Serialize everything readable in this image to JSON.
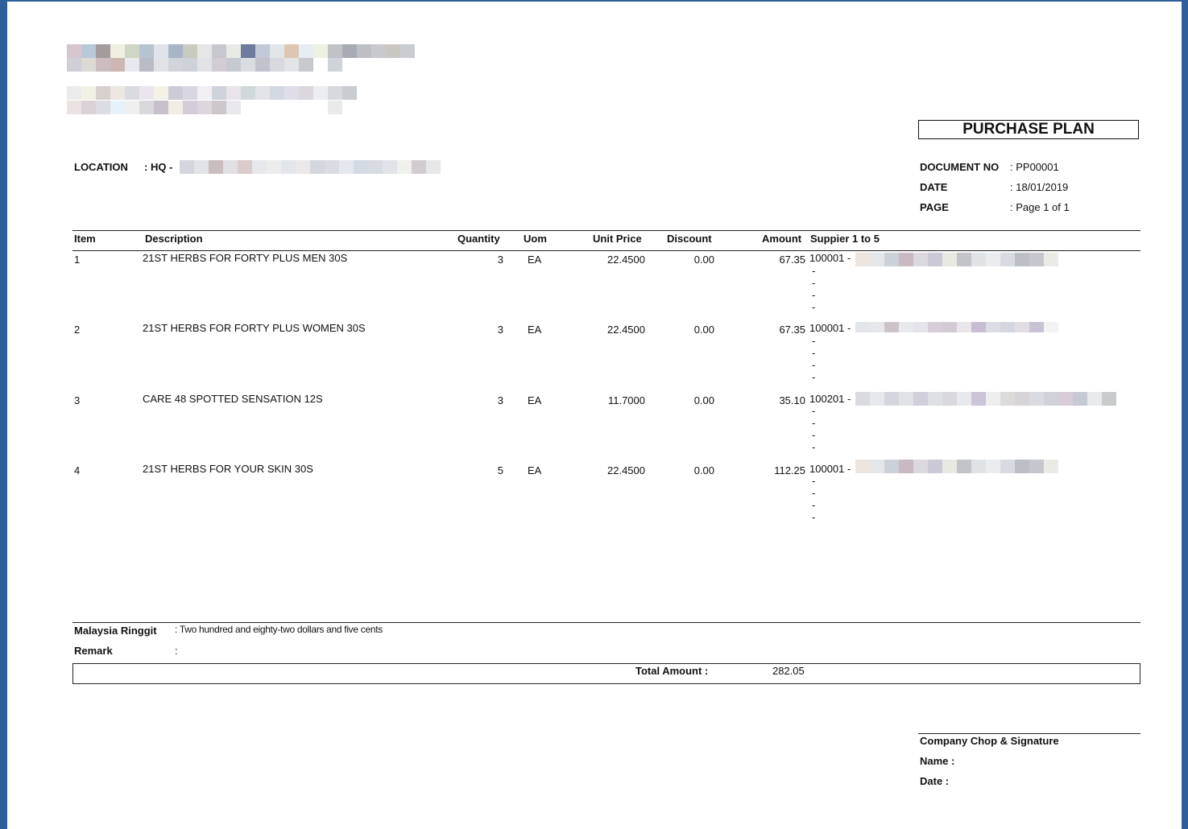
{
  "document": {
    "title": "PURCHASE PLAN",
    "location_label": "LOCATION",
    "location_value": ": HQ -",
    "meta": [
      {
        "label": "DOCUMENT NO",
        "value": ": PP00001"
      },
      {
        "label": "DATE",
        "value": ": 18/01/2019"
      },
      {
        "label": "PAGE",
        "value": ": Page 1 of 1"
      }
    ]
  },
  "table": {
    "headers": {
      "item": "Item",
      "description": "Description",
      "quantity": "Quantity",
      "uom": "Uom",
      "unit_price": "Unit Price",
      "discount": "Discount",
      "amount": "Amount",
      "supplier": "Suppier 1 to 5"
    },
    "rows": [
      {
        "item": "1",
        "description": "21ST HERBS FOR FORTY PLUS MEN 30S",
        "quantity": "3",
        "uom": "EA",
        "unit_price": "22.4500",
        "discount": "0.00",
        "amount": "67.35",
        "supplier": "100001 -",
        "dashes": [
          "-",
          "-",
          "-",
          "-"
        ]
      },
      {
        "item": "2",
        "description": "21ST HERBS FOR FORTY PLUS WOMEN 30S",
        "quantity": "3",
        "uom": "EA",
        "unit_price": "22.4500",
        "discount": "0.00",
        "amount": "67.35",
        "supplier": "100001 -",
        "dashes": [
          "-",
          "-",
          "-",
          "-"
        ]
      },
      {
        "item": "3",
        "description": "CARE 48 SPOTTED SENSATION 12S",
        "quantity": "3",
        "uom": "EA",
        "unit_price": "11.7000",
        "discount": "0.00",
        "amount": "35.10",
        "supplier": "100201 -",
        "dashes": [
          "-",
          "-",
          "-",
          "-"
        ]
      },
      {
        "item": "4",
        "description": "21ST HERBS FOR YOUR SKIN 30S",
        "quantity": "5",
        "uom": "EA",
        "unit_price": "22.4500",
        "discount": "0.00",
        "amount": "112.25",
        "supplier": "100001 -",
        "dashes": [
          "-",
          "-",
          "-",
          "-"
        ]
      }
    ]
  },
  "footer": {
    "currency_label": "Malaysia Ringgit",
    "currency_words": ": Two hundred and eighty-two dollars and five cents",
    "remark_label": "Remark",
    "remark_value": ":",
    "total_label": "Total Amount :",
    "total_value": "282.05"
  },
  "signature": {
    "title": "Company Chop & Signature",
    "name_label": "Name :",
    "date_label": "Date :"
  }
}
